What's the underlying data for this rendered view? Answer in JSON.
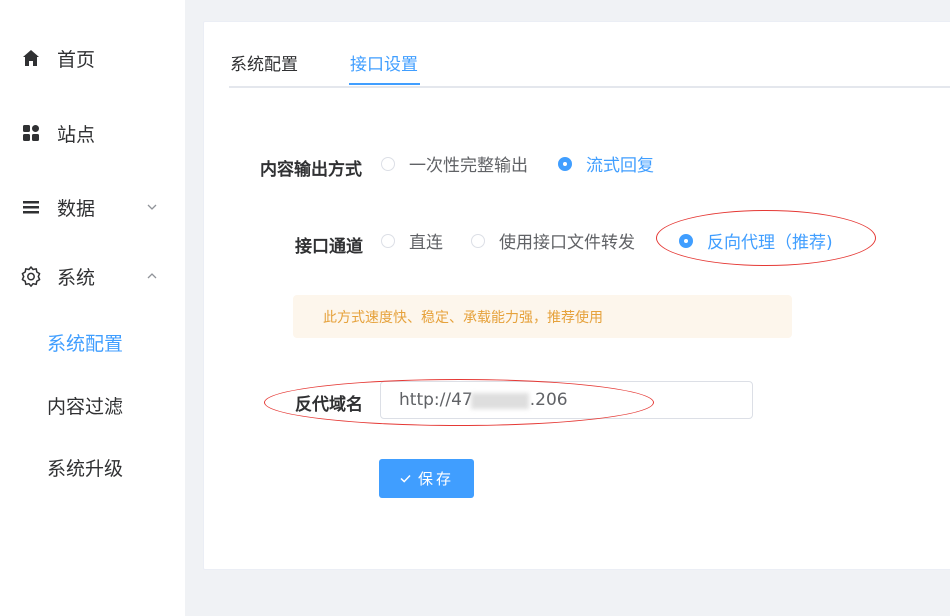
{
  "sidebar": {
    "items": [
      {
        "label": "首页",
        "icon": "home-icon"
      },
      {
        "label": "站点",
        "icon": "grid-icon"
      },
      {
        "label": "数据",
        "icon": "menu-list-icon",
        "arrow": "chevron-down-icon"
      },
      {
        "label": "系统",
        "icon": "gear-icon",
        "arrow": "chevron-up-icon"
      }
    ],
    "subitems": [
      {
        "label": "系统配置",
        "active": true
      },
      {
        "label": "内容过滤",
        "active": false
      },
      {
        "label": "系统升级",
        "active": false
      }
    ]
  },
  "tabs": [
    {
      "label": "系统配置",
      "active": false
    },
    {
      "label": "接口设置",
      "active": true
    }
  ],
  "form": {
    "output_mode": {
      "label": "内容输出方式",
      "options": [
        {
          "label": "一次性完整输出",
          "checked": false
        },
        {
          "label": "流式回复",
          "checked": true
        }
      ]
    },
    "channel": {
      "label": "接口通道",
      "options": [
        {
          "label": "直连",
          "checked": false
        },
        {
          "label": "使用接口文件转发",
          "checked": false
        },
        {
          "label": "反向代理（推荐)",
          "checked": true
        }
      ]
    },
    "tip": "此方式速度快、稳定、承载能力强，推荐使用",
    "domain": {
      "label": "反代域名",
      "value_prefix": "http://47",
      "value_suffix": ".206"
    },
    "save_label": "保存"
  },
  "colors": {
    "primary": "#409eff",
    "warning_text": "#e6a23c",
    "warning_bg": "#fdf6ec",
    "annotation": "#e53935"
  }
}
